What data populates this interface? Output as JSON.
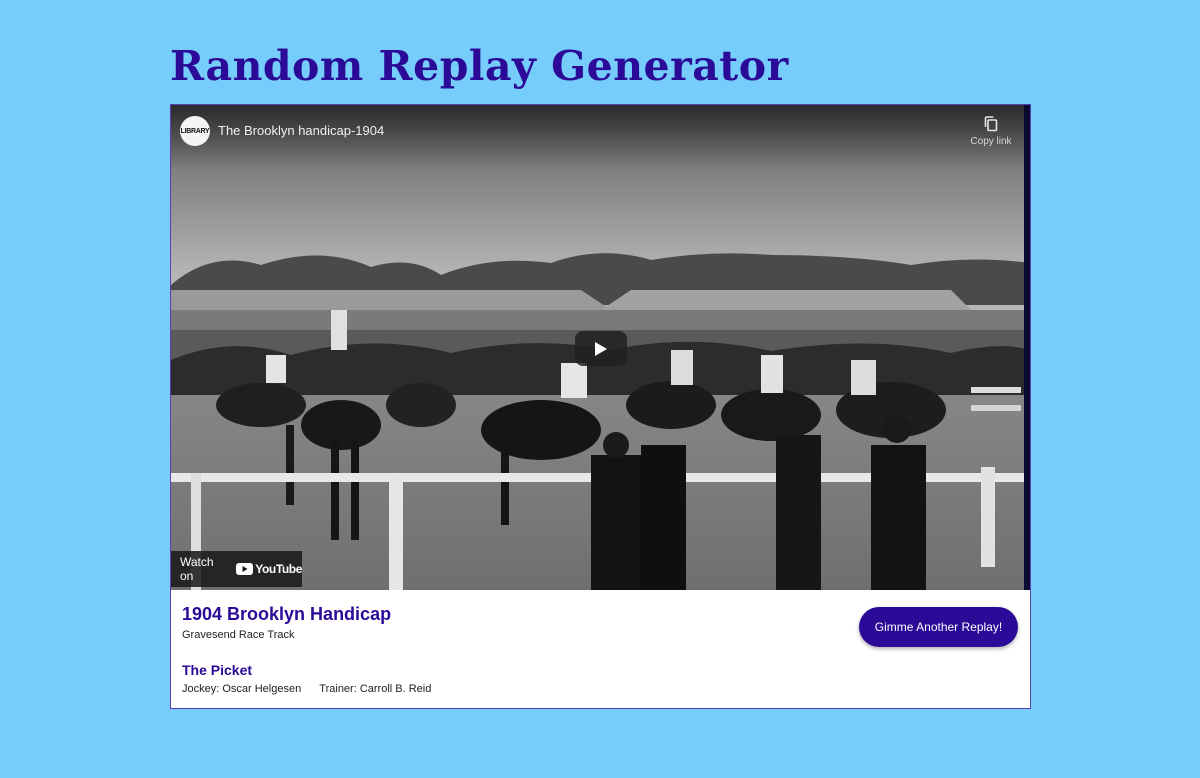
{
  "page": {
    "title": "Random Replay Generator",
    "background_color": "#76cdfc",
    "accent_color": "#2a0a96"
  },
  "video": {
    "channel_avatar_text": "LIBRARY",
    "title": "The Brooklyn handicap-1904",
    "copy_link_label": "Copy link",
    "watch_on_label": "Watch on",
    "youtube_label": "YouTube"
  },
  "race": {
    "name": "1904 Brooklyn Handicap",
    "track": "Gravesend Race Track",
    "winner": "The Picket",
    "jockey": "Jockey: Oscar Helgesen",
    "trainer": "Trainer: Carroll B. Reid"
  },
  "actions": {
    "replay_button_label": "Gimme Another Replay!"
  }
}
